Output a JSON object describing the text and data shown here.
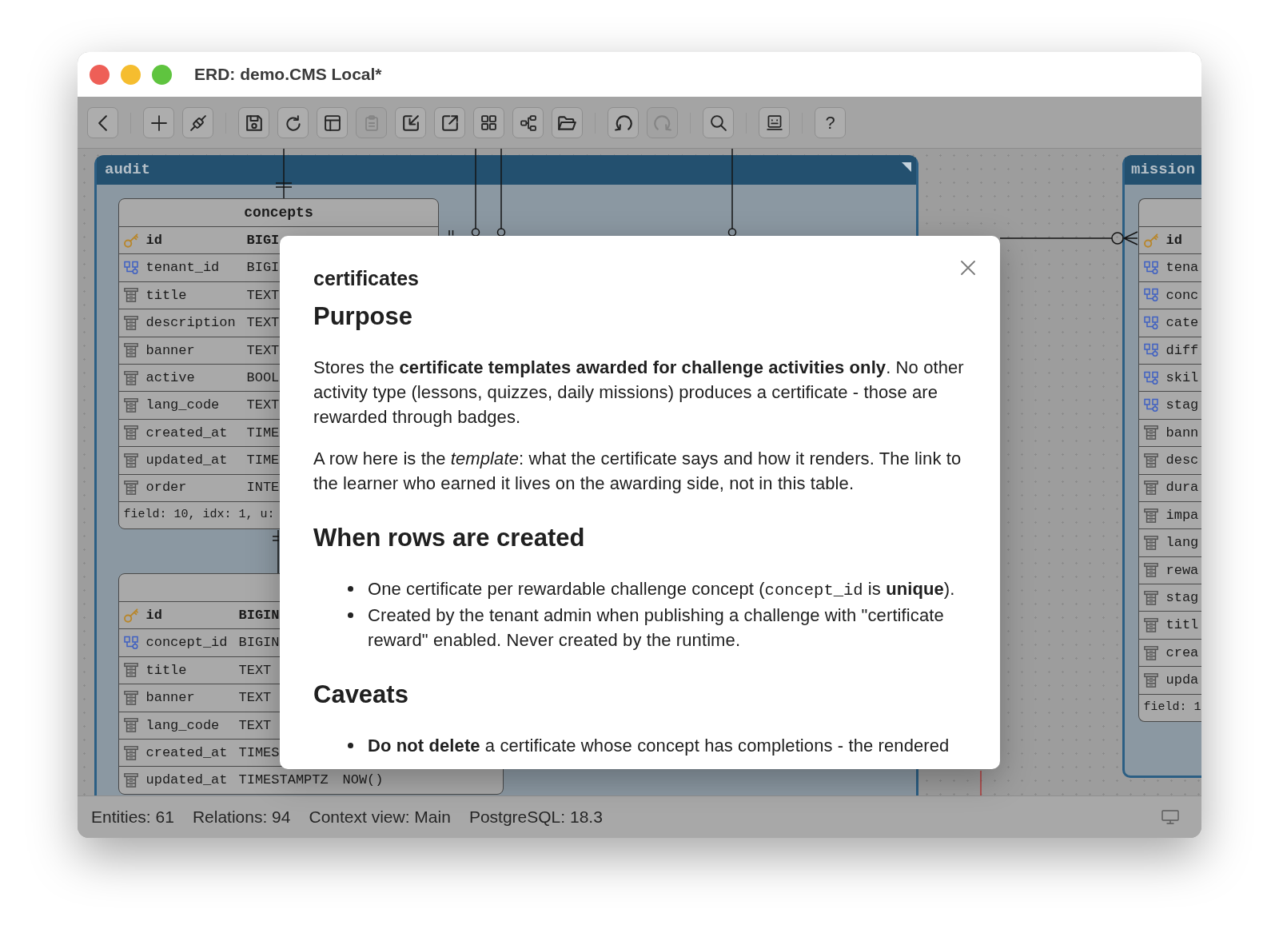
{
  "window": {
    "title": "ERD: demo.CMS Local*"
  },
  "toolbar": {
    "groups": [
      [
        {
          "kind": "icon",
          "disabled": false
        }
      ],
      [
        {
          "kind": "icon",
          "disabled": false
        },
        {
          "kind": "icon",
          "disabled": false
        }
      ],
      [
        {
          "kind": "icon",
          "disabled": false
        },
        {
          "kind": "icon",
          "disabled": false
        },
        {
          "kind": "icon",
          "disabled": false
        },
        {
          "kind": "icon",
          "disabled": true
        },
        {
          "kind": "icon",
          "disabled": false
        },
        {
          "kind": "icon",
          "disabled": false
        },
        {
          "kind": "icon",
          "disabled": false
        },
        {
          "kind": "icon",
          "disabled": false
        },
        {
          "kind": "icon",
          "disabled": false
        }
      ],
      [
        {
          "kind": "icon",
          "disabled": false
        },
        {
          "kind": "icon",
          "disabled": true
        }
      ],
      [
        {
          "kind": "icon",
          "disabled": false
        }
      ],
      [
        {
          "kind": "icon",
          "disabled": false
        }
      ],
      [
        {
          "kind": "text",
          "label": "?",
          "disabled": false
        }
      ]
    ]
  },
  "canvas": {
    "groups": [
      {
        "name": "audit",
        "tables": [
          {
            "name": "concepts",
            "columns": [
              {
                "kind": "pk",
                "name": "id",
                "type": "BIGI"
              },
              {
                "kind": "fk",
                "name": "tenant_id",
                "type": "BIGI"
              },
              {
                "kind": "column",
                "name": "title",
                "type": "TEXT"
              },
              {
                "kind": "column",
                "name": "description",
                "type": "TEXT"
              },
              {
                "kind": "column",
                "name": "banner",
                "type": "TEXT"
              },
              {
                "kind": "column",
                "name": "active",
                "type": "BOOL"
              },
              {
                "kind": "column",
                "name": "lang_code",
                "type": "TEXT"
              },
              {
                "kind": "column",
                "name": "created_at",
                "type": "TIME"
              },
              {
                "kind": "column",
                "name": "updated_at",
                "type": "TIME"
              },
              {
                "kind": "column",
                "name": "order",
                "type": "INTE"
              }
            ],
            "footer": "field: 10, idx: 1, u:"
          },
          {
            "columns": [
              {
                "kind": "pk",
                "name": "id",
                "type": "BIGIN"
              },
              {
                "kind": "fk",
                "name": "concept_id",
                "type": "BIGIN"
              },
              {
                "kind": "column",
                "name": "title",
                "type": "TEXT"
              },
              {
                "kind": "column",
                "name": "banner",
                "type": "TEXT"
              },
              {
                "kind": "column",
                "name": "lang_code",
                "type": "TEXT"
              },
              {
                "kind": "column",
                "name": "created_at",
                "type": "TIMES"
              },
              {
                "kind": "column",
                "name": "updated_at",
                "type": "TIMESTAMPTZ",
                "default": "NOW()"
              }
            ]
          }
        ]
      },
      {
        "name": "mission",
        "tables": [
          {
            "columns": [
              {
                "kind": "pk",
                "name": "id"
              },
              {
                "kind": "fk",
                "name": "tena"
              },
              {
                "kind": "fk",
                "name": "conc"
              },
              {
                "kind": "fk",
                "name": "cate"
              },
              {
                "kind": "fk",
                "name": "diff"
              },
              {
                "kind": "fk",
                "name": "skil"
              },
              {
                "kind": "fk",
                "name": "stag"
              },
              {
                "kind": "column",
                "name": "bann"
              },
              {
                "kind": "column",
                "name": "desc"
              },
              {
                "kind": "column",
                "name": "dura"
              },
              {
                "kind": "column",
                "name": "impa"
              },
              {
                "kind": "column",
                "name": "lang"
              },
              {
                "kind": "column",
                "name": "rewa"
              },
              {
                "kind": "column",
                "name": "stag"
              },
              {
                "kind": "column",
                "name": "titl"
              },
              {
                "kind": "column",
                "name": "crea"
              },
              {
                "kind": "column",
                "name": "upda"
              }
            ],
            "footer": "field: 1"
          }
        ]
      }
    ]
  },
  "dialog": {
    "title": "certificates",
    "sections": [
      {
        "heading": "Purpose",
        "blocks": [
          {
            "kind": "paragraph",
            "text": "Stores the **certificate templates awarded for challenge activities only**. No other activity type (lessons, quizzes, daily missions) produces a certificate - those are rewarded through badges."
          },
          {
            "kind": "paragraph",
            "text": "A row here is the *template*: what the certificate says and how it renders. The link to the learner who earned it lives on the awarding side, not in this table."
          }
        ]
      },
      {
        "heading": "When rows are created",
        "blocks": [
          {
            "kind": "list",
            "items": [
              {
                "runs": [
                  {
                    "kind": "text",
                    "text": "One certificate per rewardable challenge concept ("
                  },
                  {
                    "kind": "code",
                    "text": "concept_id"
                  },
                  {
                    "kind": "text",
                    "text": " is **unique**)."
                  }
                ]
              },
              {
                "runs": [
                  {
                    "kind": "text",
                    "text": "Created by the tenant admin when publishing a challenge with \"certificate reward\" enabled. Never created by the runtime."
                  }
                ]
              }
            ]
          }
        ]
      },
      {
        "heading": "Caveats",
        "blocks": [
          {
            "kind": "list",
            "items": [
              {
                "runs": [
                  {
                    "kind": "text",
                    "text": "**Do not delete** a certificate whose concept has completions - the rendered"
                  }
                ]
              }
            ]
          }
        ]
      }
    ]
  },
  "status_bar": {
    "items": [
      "Entities: 61",
      "Relations: 94",
      "Context view: Main",
      "PostgreSQL: 18.3"
    ]
  }
}
